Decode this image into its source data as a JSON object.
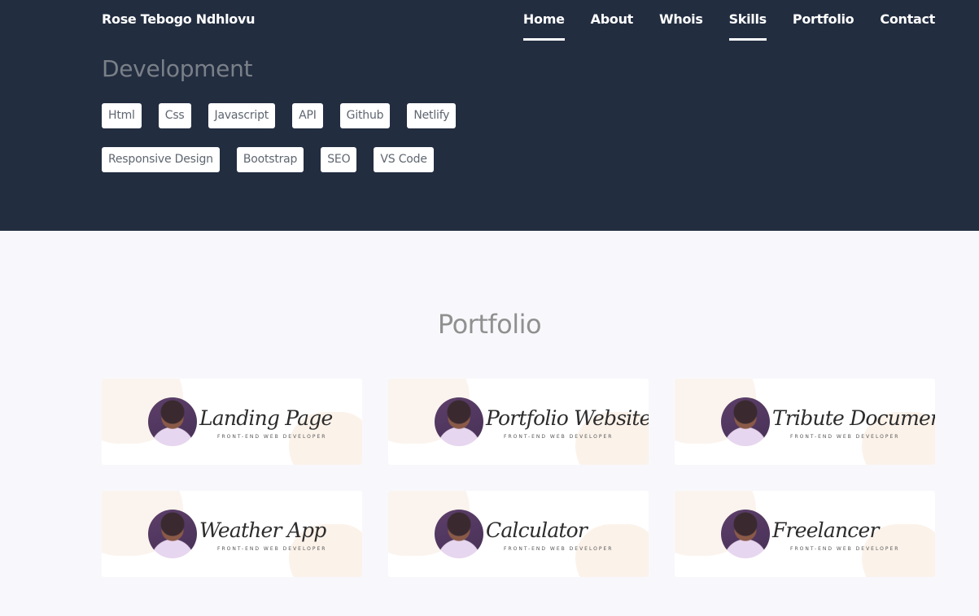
{
  "brand": "Rose Tebogo Ndhlovu",
  "nav": [
    "Home",
    "About",
    "Whois",
    "Skills",
    "Portfolio",
    "Contact"
  ],
  "development": {
    "title": "Development",
    "row1": [
      "Html",
      "Css",
      "Javascript",
      "API",
      "Github",
      "Netlify"
    ],
    "row2": [
      "Responsive Design",
      "Bootstrap",
      "SEO",
      "VS Code"
    ]
  },
  "portfolio": {
    "title": "Portfolio",
    "subtitle": "FRONT-END WEB DEVELOPER",
    "cards": [
      "Landing Page",
      "Portfolio Website",
      "Tribute Documentation",
      "Weather App",
      "Calculator",
      "Freelancer"
    ]
  },
  "colors": {
    "header_bg": "#222d40",
    "page_bg": "#f8f8fc"
  }
}
